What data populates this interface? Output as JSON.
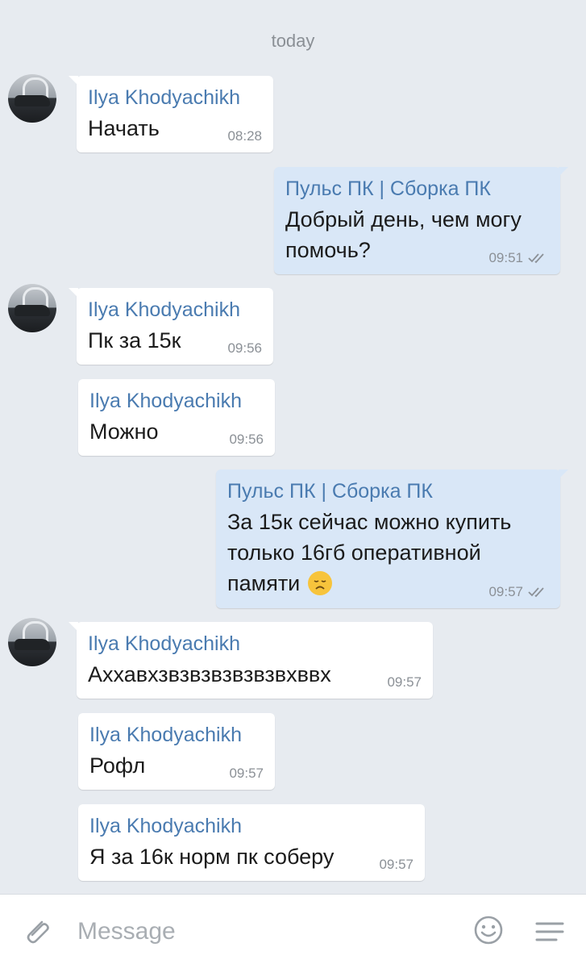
{
  "date_separator": "today",
  "messages": [
    {
      "sender": "Ilya Khodyachikh",
      "text": "Начать",
      "time": "08:28",
      "direction": "in"
    },
    {
      "sender": "Пульс ПК | Сборка ПК",
      "text": "Добрый день, чем могу помочь?",
      "time": "09:51",
      "direction": "out",
      "status": "read"
    },
    {
      "sender": "Ilya Khodyachikh",
      "text": "Пк за 15к",
      "time": "09:56",
      "direction": "in"
    },
    {
      "sender": "Ilya Khodyachikh",
      "text": "Можно",
      "time": "09:56",
      "direction": "in"
    },
    {
      "sender": "Пульс ПК | Сборка ПК",
      "text": "За 15к сейчас можно купить только 16гб оперативной памяти",
      "time": "09:57",
      "direction": "out",
      "status": "read",
      "emoji": "disappointed-face"
    },
    {
      "sender": "Ilya Khodyachikh",
      "text": "Аххавхзвзвзвзвзвзвхввх",
      "time": "09:57",
      "direction": "in"
    },
    {
      "sender": "Ilya Khodyachikh",
      "text": "Рофл",
      "time": "09:57",
      "direction": "in"
    },
    {
      "sender": "Ilya Khodyachikh",
      "text": "Я за 16к норм пк соберу",
      "time": "09:57",
      "direction": "in"
    }
  ],
  "composer": {
    "placeholder": "Message",
    "value": "",
    "attach_icon": "paperclip-icon",
    "emoji_icon": "smile-icon",
    "menu_icon": "hamburger-menu-icon"
  },
  "colors": {
    "background": "#e7ebf0",
    "incoming_bubble": "#ffffff",
    "outgoing_bubble": "#d9e7f7",
    "sender_name": "#4a7bb0",
    "meta_text": "#8b9096"
  }
}
